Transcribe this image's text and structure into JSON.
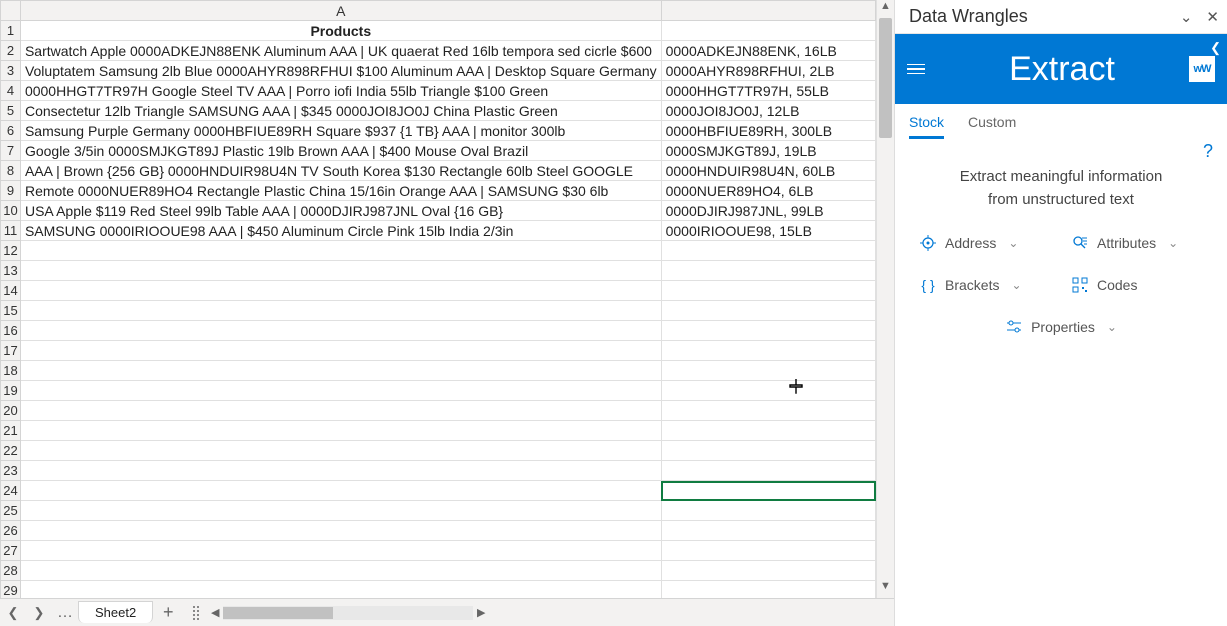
{
  "grid": {
    "col_headers": [
      "A"
    ],
    "header_row": {
      "a": "Products"
    },
    "rows": [
      {
        "a": "Sartwatch Apple      0000ADKEJN88ENK Aluminum AAA | UK  quaerat Red 16lb tempora sed cicrle $600",
        "b": "0000ADKEJN88ENK, 16LB"
      },
      {
        "a": "Voluptatem Samsung        2lb Blue 0000AHYR898RFHUI $100 Aluminum AAA | Desktop Square Germany",
        "b": "0000AHYR898RFHUI, 2LB"
      },
      {
        "a": "0000HHGT7TR97H Google      Steel TV AAA | Porro iofi India 55lb Triangle $100 Green",
        "b": "0000HHGT7TR97H, 55LB"
      },
      {
        "a": "Consectetur 12lb Triangle   SAMSUNG      AAA | $345 0000JOI8JO0J China Plastic Green",
        "b": "0000JOI8JO0J, 12LB"
      },
      {
        "a": "Samsung        Purple Germany 0000HBFIUE89RH Square $937 {1 TB} AAA |  monitor 300lb",
        "b": "0000HBFIUE89RH, 300LB"
      },
      {
        "a": "Google      3/5in  0000SMJKGT89J  Plastic 19lb Brown AAA | $400 Mouse Oval Brazil",
        "b": "0000SMJKGT89J, 19LB"
      },
      {
        "a": "AAA | Brown {256 GB} 0000HNDUIR98U4N TV South Korea  $130  Rectangle 60lb Steel GOOGLE",
        "b": "0000HNDUIR98U4N, 60LB"
      },
      {
        "a": "Remote 0000NUER89HO4 Rectangle Plastic China 15/16in  Orange AAA | SAMSUNG       $30 6lb",
        "b": "0000NUER89HO4, 6LB"
      },
      {
        "a": "USA Apple        $119 Red Steel 99lb Table AAA | 0000DJIRJ987JNL Oval {16 GB}",
        "b": "0000DJIRJ987JNL, 99LB"
      },
      {
        "a": "SAMSUNG        0000IRIOOUE98    AAA | $450 Aluminum Circle Pink 15lb India 2/3in",
        "b": "0000IRIOOUE98, 15LB"
      }
    ],
    "selected_cell": "B24",
    "active_sheet": "Sheet2"
  },
  "panel": {
    "title": "Data Wrangles",
    "banner": "Extract",
    "logo_text": "wW",
    "tabs": {
      "stock": "Stock",
      "custom": "Custom"
    },
    "description_l1": "Extract meaningful information",
    "description_l2": "from unstructured text",
    "cards": {
      "address": "Address",
      "attributes": "Attributes",
      "brackets": "Brackets",
      "codes": "Codes",
      "properties": "Properties"
    }
  }
}
